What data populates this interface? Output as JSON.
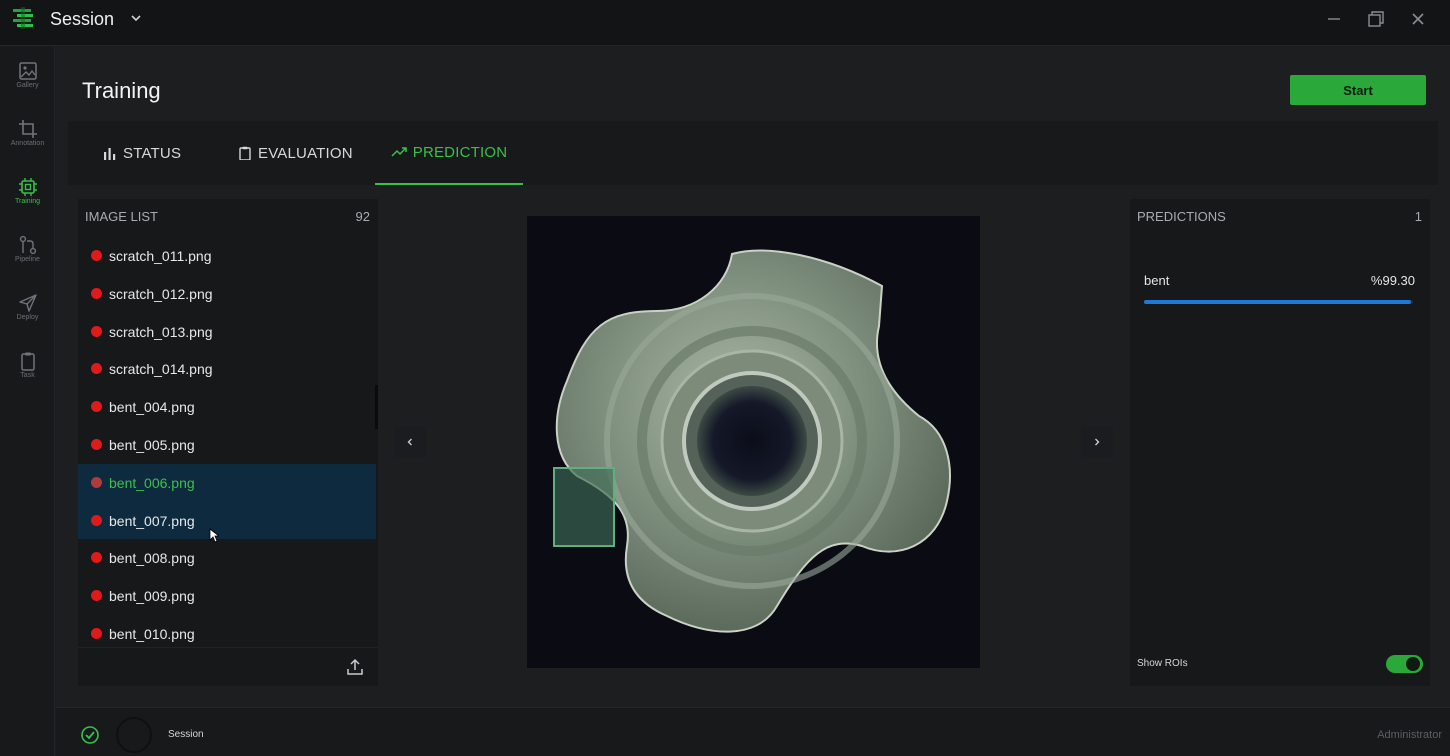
{
  "app": {
    "title": "Session"
  },
  "sidebar": {
    "items": [
      {
        "label": "Gallery",
        "icon": "image-icon"
      },
      {
        "label": "Annotation",
        "icon": "crop-icon"
      },
      {
        "label": "Training",
        "icon": "chip-icon",
        "active": true
      },
      {
        "label": "Pipeline",
        "icon": "pipeline-icon"
      },
      {
        "label": "Deploy",
        "icon": "send-icon"
      },
      {
        "label": "Task",
        "icon": "clipboard-icon"
      }
    ]
  },
  "header": {
    "title": "Training",
    "start_label": "Start"
  },
  "tabs": [
    {
      "label": "STATUS",
      "icon": "bar-chart-icon"
    },
    {
      "label": "EVALUATION",
      "icon": "clipboard-icon"
    },
    {
      "label": "PREDICTION",
      "icon": "trend-up-icon",
      "active": true
    }
  ],
  "image_list": {
    "title": "IMAGE LIST",
    "count": "92",
    "items": [
      {
        "name": "scratch_011.png"
      },
      {
        "name": "scratch_012.png"
      },
      {
        "name": "scratch_013.png"
      },
      {
        "name": "scratch_014.png"
      },
      {
        "name": "bent_004.png"
      },
      {
        "name": "bent_005.png"
      },
      {
        "name": "bent_006.png",
        "selected": true
      },
      {
        "name": "bent_007.png"
      },
      {
        "name": "bent_008.png"
      },
      {
        "name": "bent_009.png"
      },
      {
        "name": "bent_010.png"
      }
    ]
  },
  "predictions": {
    "title": "PREDICTIONS",
    "count": "1",
    "items": [
      {
        "label": "bent",
        "score": "%99.30",
        "confidence": 0.993
      }
    ],
    "show_rois_label": "Show ROIs",
    "show_rois": true
  },
  "status_bar": {
    "session": "Session",
    "user": "Administrator"
  },
  "colors": {
    "accent": "#39c04a",
    "danger": "#e01a1a",
    "progress": "#1e78d6"
  }
}
